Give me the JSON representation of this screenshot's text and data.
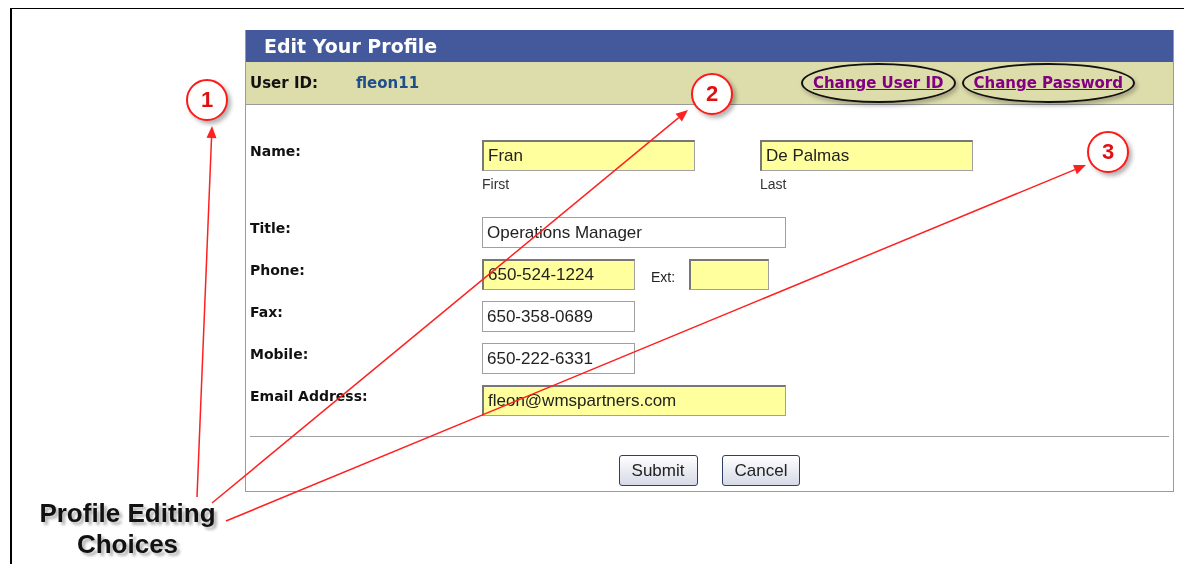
{
  "panel": {
    "title": "Edit Your Profile",
    "user_id": {
      "label": "User ID:",
      "value": "fleon11"
    },
    "links": [
      {
        "label": "Change User ID",
        "circled": true
      },
      {
        "label": "Change Password",
        "circled": true
      }
    ],
    "fields": [
      {
        "label": "Name:",
        "inputs": [
          {
            "value": "Fran",
            "sublabel": "First",
            "highlighted": true,
            "kind": "medium"
          },
          {
            "value": "De Palmas",
            "sublabel": "Last",
            "highlighted": true,
            "kind": "medium"
          }
        ]
      },
      {
        "label": "Title:",
        "inputs": [
          {
            "value": "Operations Manager",
            "highlighted": false,
            "kind": "long"
          }
        ]
      },
      {
        "label": "Phone:",
        "inputs": [
          {
            "value": "650-524-1224",
            "highlighted": true,
            "kind": "short"
          },
          {
            "prefix": "Ext:",
            "highlighted": true,
            "kind": "tiny"
          }
        ]
      },
      {
        "label": "Fax:",
        "inputs": [
          {
            "value": "650-358-0689",
            "highlighted": false,
            "kind": "short"
          }
        ]
      },
      {
        "label": "Mobile:",
        "inputs": [
          {
            "value": "650-222-6331",
            "highlighted": false,
            "kind": "short"
          }
        ]
      },
      {
        "label": "Email Address:",
        "inputs": [
          {
            "value": "fleon@wmspartners.com",
            "highlighted": true,
            "kind": "long"
          }
        ]
      }
    ],
    "buttons": [
      "Submit",
      "Cancel"
    ]
  },
  "annotations": {
    "markers": [
      "1",
      "2",
      "3"
    ],
    "callout": "Profile Editing Choices"
  }
}
